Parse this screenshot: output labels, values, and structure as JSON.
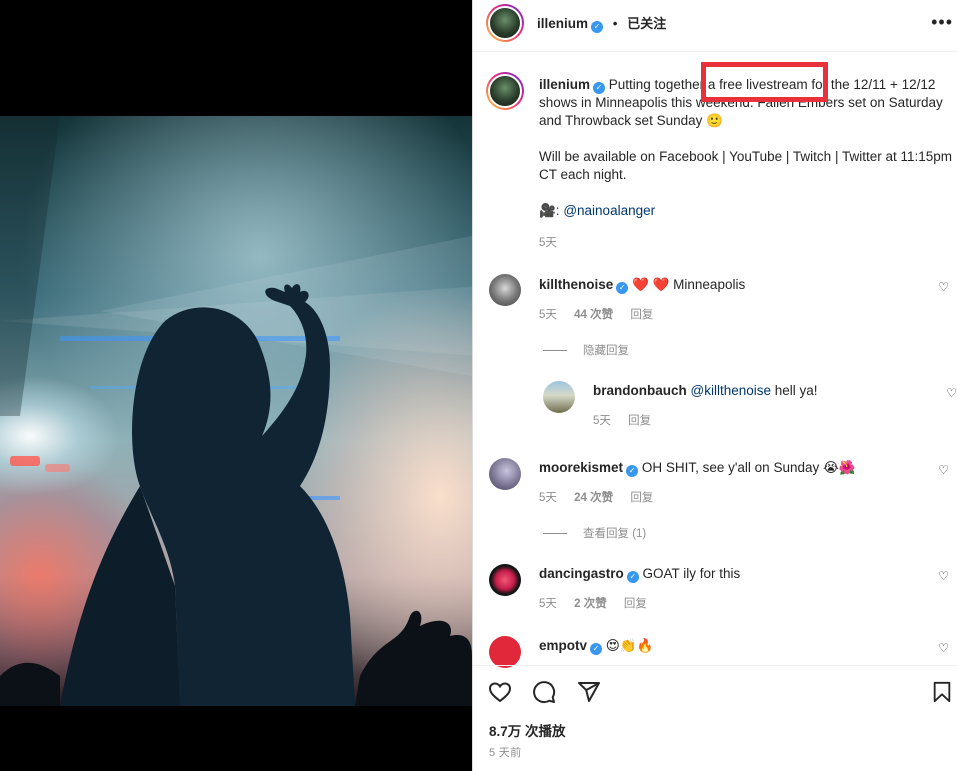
{
  "post": {
    "author": "illenium",
    "header_dot": "•",
    "follow_label": "已关注",
    "more_label": "•••",
    "caption": {
      "line1": "Putting together a free livestream for the 12/11 + 12/12 shows in Minneapolis this weekend. Fallen Embers set on Saturday and Throwback set Sunday 🙂",
      "line2": "Will be available on Facebook | YouTube | Twitch | Twitter at 11:15pm CT each night.",
      "camera": "🎥:",
      "credit": "@nainoalanger",
      "time": "5天"
    }
  },
  "comments": [
    {
      "user": "killthenoise",
      "text": "❤️ ❤️ Minneapolis",
      "time": "5天",
      "likes": "44 次赞",
      "reply": "回复",
      "toggle": "隐藏回复",
      "replies": [
        {
          "user": "brandonbauch",
          "mention": "@killthenoise",
          "text": " hell ya!",
          "time": "5天",
          "reply": "回复"
        }
      ]
    },
    {
      "user": "moorekismet",
      "text": "OH SHIT, see y'all on Sunday 😭🌺",
      "time": "5天",
      "likes": "24 次赞",
      "reply": "回复",
      "toggle": "查看回复 (1)"
    },
    {
      "user": "dancingastro",
      "text": "GOAT ily for this",
      "time": "5天",
      "likes": "2 次赞",
      "reply": "回复"
    },
    {
      "user": "empotv",
      "text": "😍👏🔥"
    }
  ],
  "footer": {
    "views": "8.7万 次播放",
    "posted": "5 天前"
  },
  "icons": {
    "like": "heart-icon",
    "comment": "comment-icon",
    "share": "share-icon",
    "save": "bookmark-icon"
  },
  "colors": {
    "verified": "#3897f0",
    "highlight": "#e8313a",
    "mention": "#00376b"
  }
}
